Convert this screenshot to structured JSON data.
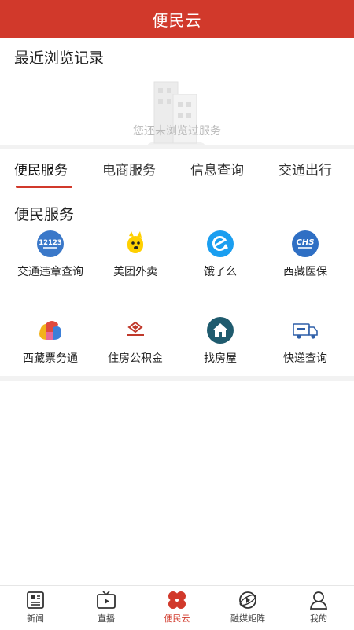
{
  "header": {
    "title": "便民云"
  },
  "recent": {
    "title": "最近浏览记录",
    "empty_text": "您还未浏览过服务"
  },
  "tabs": [
    {
      "label": "便民服务",
      "active": true
    },
    {
      "label": "电商服务",
      "active": false
    },
    {
      "label": "信息查询",
      "active": false
    },
    {
      "label": "交通出行",
      "active": false
    }
  ],
  "services": {
    "title": "便民服务",
    "items": [
      {
        "label": "交通违章查询",
        "icon": "traffic-12123-icon",
        "icon_text": "12123"
      },
      {
        "label": "美团外卖",
        "icon": "meituan-kangaroo-icon"
      },
      {
        "label": "饿了么",
        "icon": "eleme-icon"
      },
      {
        "label": "西藏医保",
        "icon": "chs-medical-icon",
        "icon_text": "CHS"
      },
      {
        "label": "西藏票务通",
        "icon": "ticket-colorful-icon"
      },
      {
        "label": "住房公积金",
        "icon": "housing-fund-icon"
      },
      {
        "label": "找房屋",
        "icon": "house-icon"
      },
      {
        "label": "快递查询",
        "icon": "delivery-truck-icon"
      }
    ]
  },
  "tabbar": [
    {
      "label": "新闻",
      "icon": "newspaper-icon",
      "active": false
    },
    {
      "label": "直播",
      "icon": "tv-play-icon",
      "active": false
    },
    {
      "label": "便民云",
      "icon": "clover-icon",
      "active": true
    },
    {
      "label": "融媒矩阵",
      "icon": "globe-matrix-icon",
      "active": false
    },
    {
      "label": "我的",
      "icon": "person-icon",
      "active": false
    }
  ],
  "colors": {
    "accent": "#d1392b",
    "divider": "#f2f2f2"
  }
}
